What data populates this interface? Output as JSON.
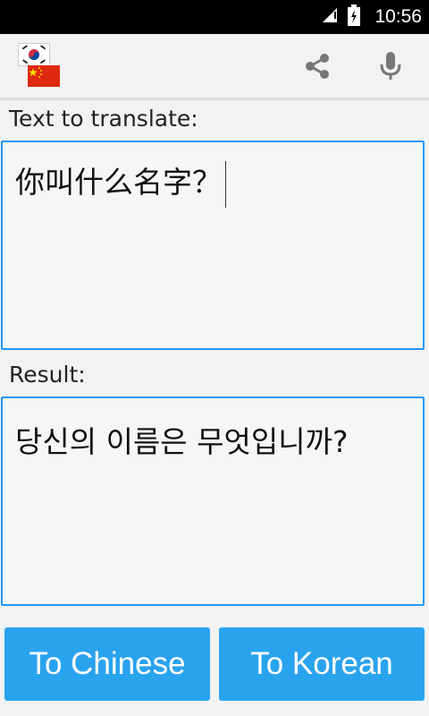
{
  "status_bar": {
    "time": "10:56",
    "icons": [
      "signal-icon",
      "battery-charging-icon"
    ]
  },
  "action_bar": {
    "flags": [
      "south-korea-flag-icon",
      "china-flag-icon"
    ],
    "actions": [
      "share-icon",
      "microphone-icon"
    ]
  },
  "input_section": {
    "label": "Text to translate:",
    "text": "你叫什么名字？"
  },
  "result_section": {
    "label": "Result:",
    "text": "당신의 이름은 무엇입니까?"
  },
  "buttons": {
    "to_chinese": "To Chinese",
    "to_korean": "To Korean"
  },
  "colors": {
    "accent": "#2196f3",
    "button": "#2aa3ee",
    "background": "#f2f2f2"
  }
}
